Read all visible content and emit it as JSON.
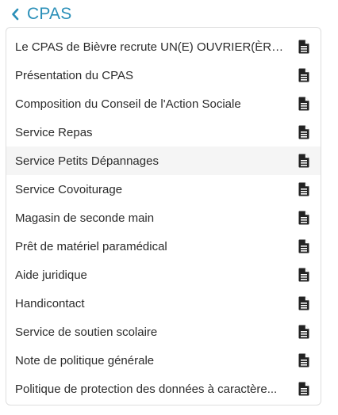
{
  "header": {
    "back_label": "CPAS",
    "icon": "chevron-left-icon",
    "accent_color": "#2a8fb8"
  },
  "list": {
    "item_icon": "document-icon",
    "hover_index": 4,
    "items": [
      {
        "label": "Le CPAS de Bièvre recrute UN(E) OUVRIER(ÈRE)..."
      },
      {
        "label": "Présentation du CPAS"
      },
      {
        "label": "Composition du Conseil de l'Action Sociale"
      },
      {
        "label": "Service Repas"
      },
      {
        "label": "Service Petits Dépannages"
      },
      {
        "label": "Service Covoiturage"
      },
      {
        "label": "Magasin de seconde main"
      },
      {
        "label": "Prêt de matériel paramédical"
      },
      {
        "label": "Aide juridique"
      },
      {
        "label": "Handicontact"
      },
      {
        "label": "Service de soutien scolaire"
      },
      {
        "label": "Note de politique générale"
      },
      {
        "label": "Politique de protection des données à caractère..."
      }
    ]
  }
}
